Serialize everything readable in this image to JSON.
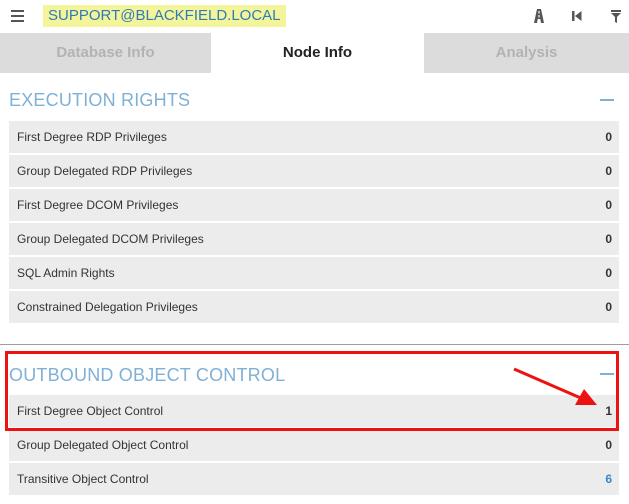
{
  "header": {
    "node_name": "SUPPORT@BLACKFIELD.LOCAL",
    "icons": [
      "hamburger-icon",
      "path-icon",
      "back-icon",
      "filter-icon"
    ]
  },
  "tabs": [
    {
      "label": "Database Info",
      "active": false
    },
    {
      "label": "Node Info",
      "active": true
    },
    {
      "label": "Analysis",
      "active": false
    }
  ],
  "execution_rights": {
    "title": "EXECUTION RIGHTS",
    "rows": [
      {
        "label": "First Degree RDP Privileges",
        "value": "0"
      },
      {
        "label": "Group Delegated RDP Privileges",
        "value": "0"
      },
      {
        "label": "First Degree DCOM Privileges",
        "value": "0"
      },
      {
        "label": "Group Delegated DCOM Privileges",
        "value": "0"
      },
      {
        "label": "SQL Admin Rights",
        "value": "0"
      },
      {
        "label": "Constrained Delegation Privileges",
        "value": "0"
      }
    ]
  },
  "outbound_object_control": {
    "title": "OUTBOUND OBJECT CONTROL",
    "rows": [
      {
        "label": "First Degree Object Control",
        "value": "1"
      },
      {
        "label": "Group Delegated Object Control",
        "value": "0"
      },
      {
        "label": "Transitive Object Control",
        "value": "6"
      }
    ]
  },
  "colors": {
    "accent": "#7fb0d6",
    "highlight": "#ee1111",
    "node_label_bg": "#f4f59a",
    "link": "#3a86c8"
  }
}
